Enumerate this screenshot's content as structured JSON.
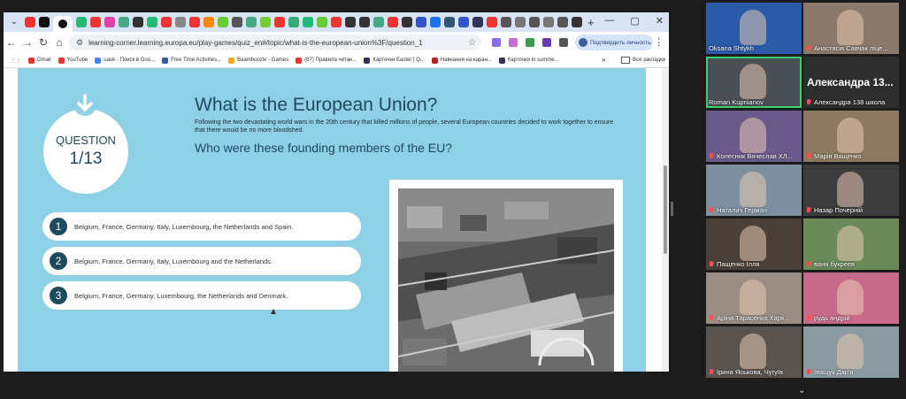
{
  "browser": {
    "address": "learning-corner.learning.europa.eu/play-games/quiz_en#/topic/what-is-the-european-union%3F/question_1",
    "verify_label": "Подтвердить личность",
    "tab_colors": [
      "#e33",
      "#111",
      "#e33",
      "#2b7",
      "#e33",
      "#d4a",
      "#4a8",
      "#333",
      "#2b7",
      "#e33",
      "#888",
      "#e33",
      "#f80",
      "#6c3",
      "#555",
      "#4a8",
      "#7c3",
      "#e33",
      "#3a7",
      "#2b7",
      "#6c3",
      "#e33",
      "#333",
      "#333",
      "#4a8",
      "#e33",
      "#333",
      "#35c",
      "#1a73e8",
      "#357",
      "#35c",
      "#335",
      "#e33",
      "#555",
      "#777",
      "#555",
      "#777",
      "#555",
      "#333"
    ],
    "bookmarks": [
      {
        "label": "Gmail",
        "color": "#e33"
      },
      {
        "label": "YouTube",
        "color": "#e33"
      },
      {
        "label": "uauk - Поиск в Goo...",
        "color": "#4285f4"
      },
      {
        "label": "Free Time Activities...",
        "color": "#35a"
      },
      {
        "label": "Baamboozle - Games",
        "color": "#f5a623"
      },
      {
        "label": "(67) Правила читан...",
        "color": "#e33"
      },
      {
        "label": "Карточки Easter | Q...",
        "color": "#335"
      },
      {
        "label": "Навчання на каран...",
        "color": "#b22"
      },
      {
        "label": "Карточки in summe...",
        "color": "#335"
      }
    ],
    "bookmarks_all": "Все закладки"
  },
  "quiz": {
    "question_label": "QUESTION",
    "question_number": "1/13",
    "title": "What is the European Union?",
    "description": "Following the two devastating world wars in the 20th century that killed millions of people, several European countries decided to work together to ensure that there would be no more bloodshed.",
    "question": "Who were these founding members of the EU?",
    "answers": [
      {
        "num": "1",
        "text": "Belgium, France, Germany, Italy, Luxembourg, the Netherlands and Spain."
      },
      {
        "num": "2",
        "text": "Belgium, France, Germany, Italy, Luxembourg and the Netherlands."
      },
      {
        "num": "3",
        "text": "Belgium, France, Germany, Luxembourg, the Netherlands and Denmark."
      }
    ]
  },
  "participants": [
    {
      "name": "Oksana Shtykh",
      "muted": false,
      "bg": "#2b5aa8"
    },
    {
      "name": "Анастасія Савчак ліце...",
      "muted": true,
      "bg": "#8b7a6c"
    },
    {
      "name": "Roman Kupriianov",
      "muted": false,
      "bg": "#4a4f55",
      "speaking": true
    },
    {
      "name": "Александра 138 школа",
      "muted": true,
      "bg": "#2d2d2d",
      "big": "Александра 13..."
    },
    {
      "name": "Колесник Вячеслав ХЛ...",
      "muted": true,
      "bg": "#6a5a8a"
    },
    {
      "name": "Марія Ващенко",
      "muted": true,
      "bg": "#8c7a60"
    },
    {
      "name": "Наталич Герман",
      "muted": true,
      "bg": "#7d8f9e"
    },
    {
      "name": "Назар Почерній",
      "muted": true,
      "bg": "#3c3c3c"
    },
    {
      "name": "Пащенко Ілля",
      "muted": true,
      "bg": "#4a4038"
    },
    {
      "name": "ваня букреев",
      "muted": true,
      "bg": "#6a8a5a"
    },
    {
      "name": "Аріна Тарасенко Харк...",
      "muted": true,
      "bg": "#9a8d82"
    },
    {
      "name": "рудь андрій",
      "muted": true,
      "bg": "#c86a8a"
    },
    {
      "name": "Ірина Яськова, Чугуїв",
      "muted": true,
      "bg": "#5a5450"
    },
    {
      "name": "Іващук Дар'я",
      "muted": true,
      "bg": "#8a9aa0"
    }
  ]
}
